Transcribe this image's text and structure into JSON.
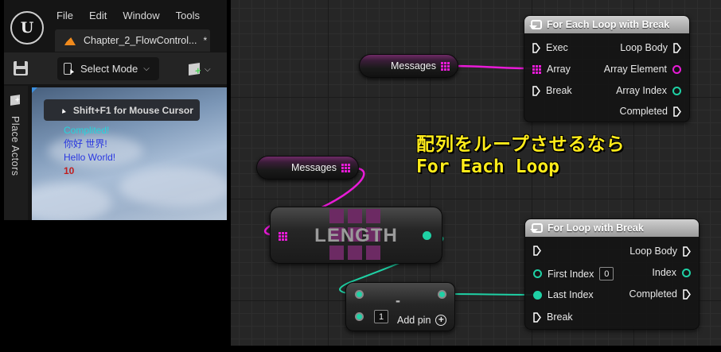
{
  "menu": {
    "items": [
      "File",
      "Edit",
      "Window",
      "Tools"
    ]
  },
  "editor": {
    "logo_text": "U",
    "doc_tab": {
      "label": "Chapter_2_FlowControl...",
      "modified_marker": "*"
    },
    "toolbar": {
      "select_mode_label": "Select Mode"
    },
    "place_actors_label": "Place Actors",
    "viewport": {
      "hint": "Shift+F1 for Mouse Cursor",
      "log_lines": [
        "Complited!",
        "你好 世界!",
        "Hello World!",
        "10"
      ]
    }
  },
  "graph": {
    "for_each_loop": {
      "title": "For Each Loop with Break",
      "inputs": {
        "exec": "Exec",
        "array": "Array",
        "break": "Break"
      },
      "outputs": {
        "loop_body": "Loop Body",
        "array_element": "Array Element",
        "array_index": "Array Index",
        "completed": "Completed"
      }
    },
    "messages_var_top": {
      "label": "Messages"
    },
    "messages_var_bottom": {
      "label": "Messages"
    },
    "length_node": {
      "title": "LENGTH"
    },
    "minus_node": {
      "operator": "-",
      "default_value": "1",
      "add_pin_label": "Add pin"
    },
    "for_loop": {
      "title": "For Loop with Break",
      "inputs": {
        "first_index": "First Index",
        "first_index_value": "0",
        "last_index": "Last Index",
        "break": "Break"
      },
      "outputs": {
        "loop_body": "Loop Body",
        "index": "Index",
        "completed": "Completed"
      }
    },
    "annotation": {
      "line1": "配列をループさせるなら",
      "line2": "For Each Loop"
    }
  },
  "colors": {
    "array_pin": "#e81bd7",
    "integer_pin": "#1fd1a5",
    "exec_pin": "#ffffff",
    "annotation_text": "#ffec1a"
  }
}
